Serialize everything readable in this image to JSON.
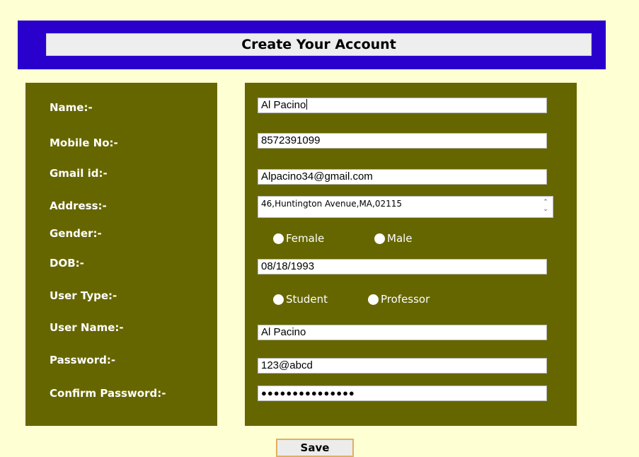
{
  "header": {
    "title": "Create Your Account"
  },
  "labels": {
    "name": "Name:-",
    "mobile": "Mobile No:-",
    "gmail": "Gmail id:-",
    "address": "Address:-",
    "gender": "Gender:-",
    "dob": "DOB:-",
    "user_type": "User Type:-",
    "user_name": "User Name:-",
    "password": "Password:-",
    "confirm_password": "Confirm Password:-"
  },
  "fields": {
    "name": "Al Pacino",
    "mobile": "8572391099",
    "gmail": "Alpacino34@gmail.com",
    "address": "46,Huntington Avenue,MA,02115",
    "dob": "08/18/1993",
    "user_name": "Al Pacino",
    "password": "123@abcd",
    "confirm_password_mask": "●●●●●●●●●●●●●●●"
  },
  "gender_options": {
    "female": "Female",
    "male": "Male"
  },
  "user_type_options": {
    "student": "Student",
    "professor": "Professor"
  },
  "buttons": {
    "save": "Save"
  },
  "colors": {
    "background": "#ffffd4",
    "header": "#2a00cc",
    "panel": "#666600"
  }
}
